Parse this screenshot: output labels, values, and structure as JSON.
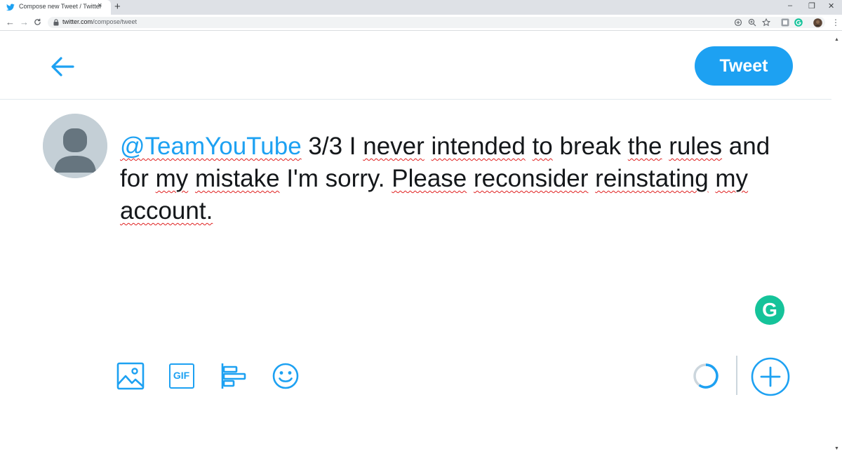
{
  "browser": {
    "tab_title": "Compose new Tweet / Twitter",
    "tab_close": "×",
    "new_tab": "+",
    "minimize": "–",
    "restore": "❐",
    "close": "✕",
    "url_host": "twitter.com",
    "url_path": "/compose/tweet",
    "back": "←",
    "forward": "→",
    "reload": "C",
    "menu": "⋮"
  },
  "header": {
    "tweet_button": "Tweet"
  },
  "compose": {
    "mention": "@TeamYouTube",
    "w1": "3/3 I",
    "w2": "never",
    "w3": "intended",
    "w4": "to",
    "w5": "break",
    "w6": "the",
    "w7": "rules",
    "w8": "and",
    "w9": "for",
    "w10": "my",
    "w11": "mistake",
    "w12": "I'm sorry.",
    "w13": "Please",
    "w14": "reconsider",
    "w15": "reinstating",
    "w16": "my",
    "w17": "account."
  },
  "grammarly": {
    "letter": "G"
  },
  "toolbar": {
    "gif_label": "GIF"
  },
  "colors": {
    "brand": "#1da1f2",
    "grammarly": "#15c39a",
    "text": "#14171a",
    "spellcheck": "#e0201f"
  },
  "icons": [
    "twitter-bird-icon",
    "lock-icon",
    "back-arrow-icon",
    "default-avatar-icon",
    "media-icon",
    "gif-icon",
    "poll-icon",
    "emoji-icon",
    "progress-ring-icon",
    "add-tweet-icon",
    "grammarly-icon"
  ]
}
